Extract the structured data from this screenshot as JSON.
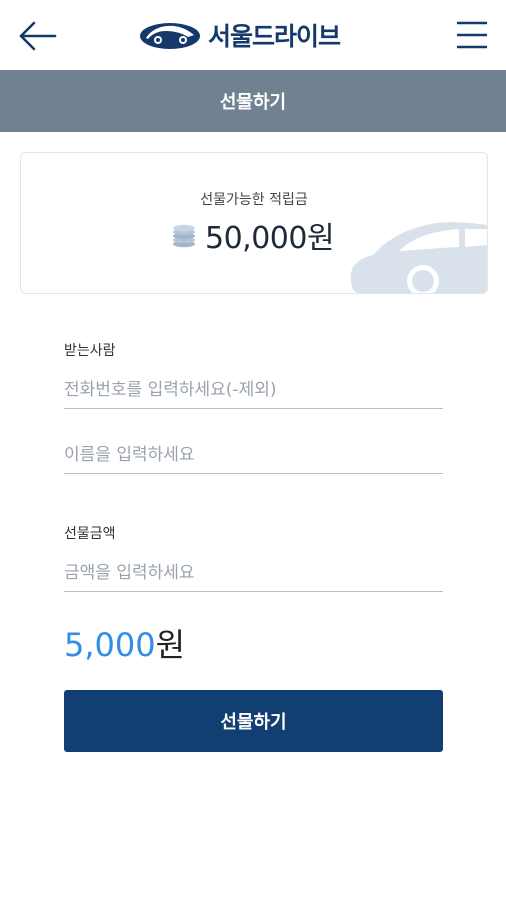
{
  "header": {
    "brand": "서울드라이브",
    "title": "선물하기"
  },
  "balance_card": {
    "label": "선물가능한 적립금",
    "amount": "50,000원"
  },
  "recipient": {
    "label": "받는사람",
    "phone_placeholder": "전화번호를 입력하세요(-제외)",
    "name_placeholder": "이름을 입력하세요"
  },
  "gift_amount": {
    "label": "선물금액",
    "placeholder": "금액을 입력하세요",
    "display_value": "5,000",
    "display_unit": "원"
  },
  "submit_label": "선물하기",
  "colors": {
    "title_bar": "#718191",
    "brand_navy": "#123f72",
    "accent_blue": "#2f8fe6"
  },
  "icons": [
    "back-arrow-icon",
    "hamburger-menu-icon",
    "car-logo-icon",
    "coins-icon",
    "car-illustration-icon"
  ]
}
